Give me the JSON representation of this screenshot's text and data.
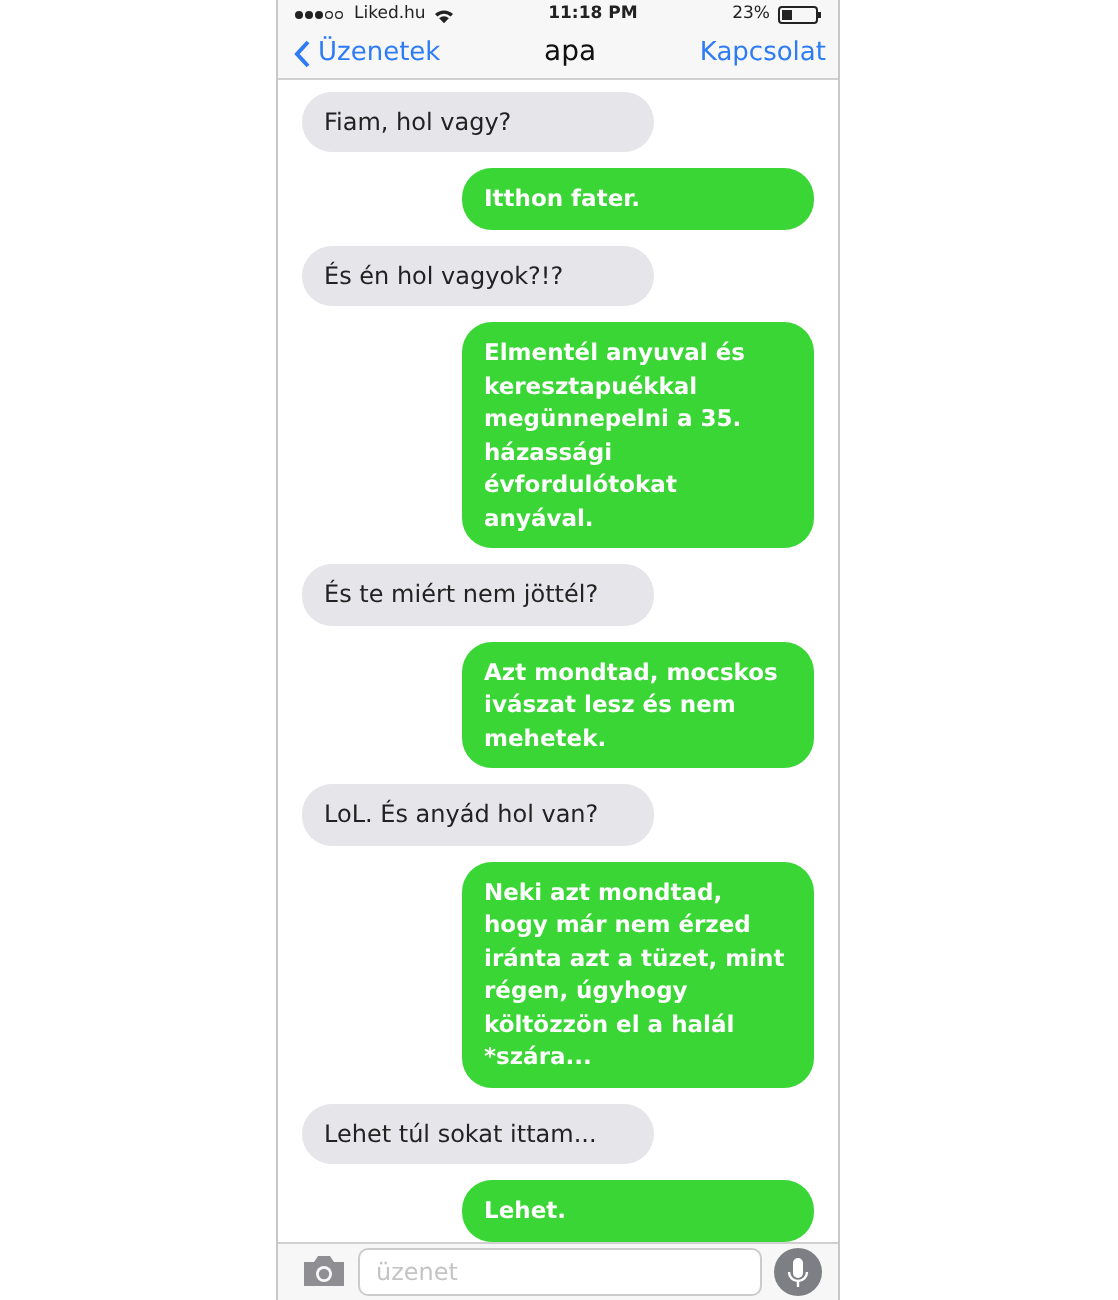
{
  "status_bar": {
    "carrier": "Liked.hu",
    "time": "11:18 PM",
    "battery": "23%"
  },
  "nav_bar": {
    "back": "Üzenetek",
    "title": "apa",
    "action": "Kapcsolat"
  },
  "messages": [
    {
      "kind": "received",
      "text": "Fiam, hol vagy?"
    },
    {
      "kind": "sent",
      "text": "Itthon fater."
    },
    {
      "kind": "received",
      "text": "És én hol vagyok?!?"
    },
    {
      "kind": "sent",
      "text": "Elmentél anyuval és keresztapuékkal megünnepelni a 35. házassági évfordulótokat anyával."
    },
    {
      "kind": "received",
      "text": "És te miért nem jöttél?"
    },
    {
      "kind": "sent",
      "text": "Azt mondtad, mocskos ivászat lesz és nem mehetek."
    },
    {
      "kind": "received",
      "text": "LoL. És anyád hol van?"
    },
    {
      "kind": "sent",
      "text": "Neki azt mondtad, hogy már nem érzed iránta azt a tüzet, mint régen, úgyhogy költözzön el a halál *szára..."
    },
    {
      "kind": "received",
      "text": "Lehet túl sokat ittam..."
    },
    {
      "kind": "sent",
      "text": "Lehet."
    }
  ],
  "composer": {
    "placeholder": "üzenet"
  }
}
